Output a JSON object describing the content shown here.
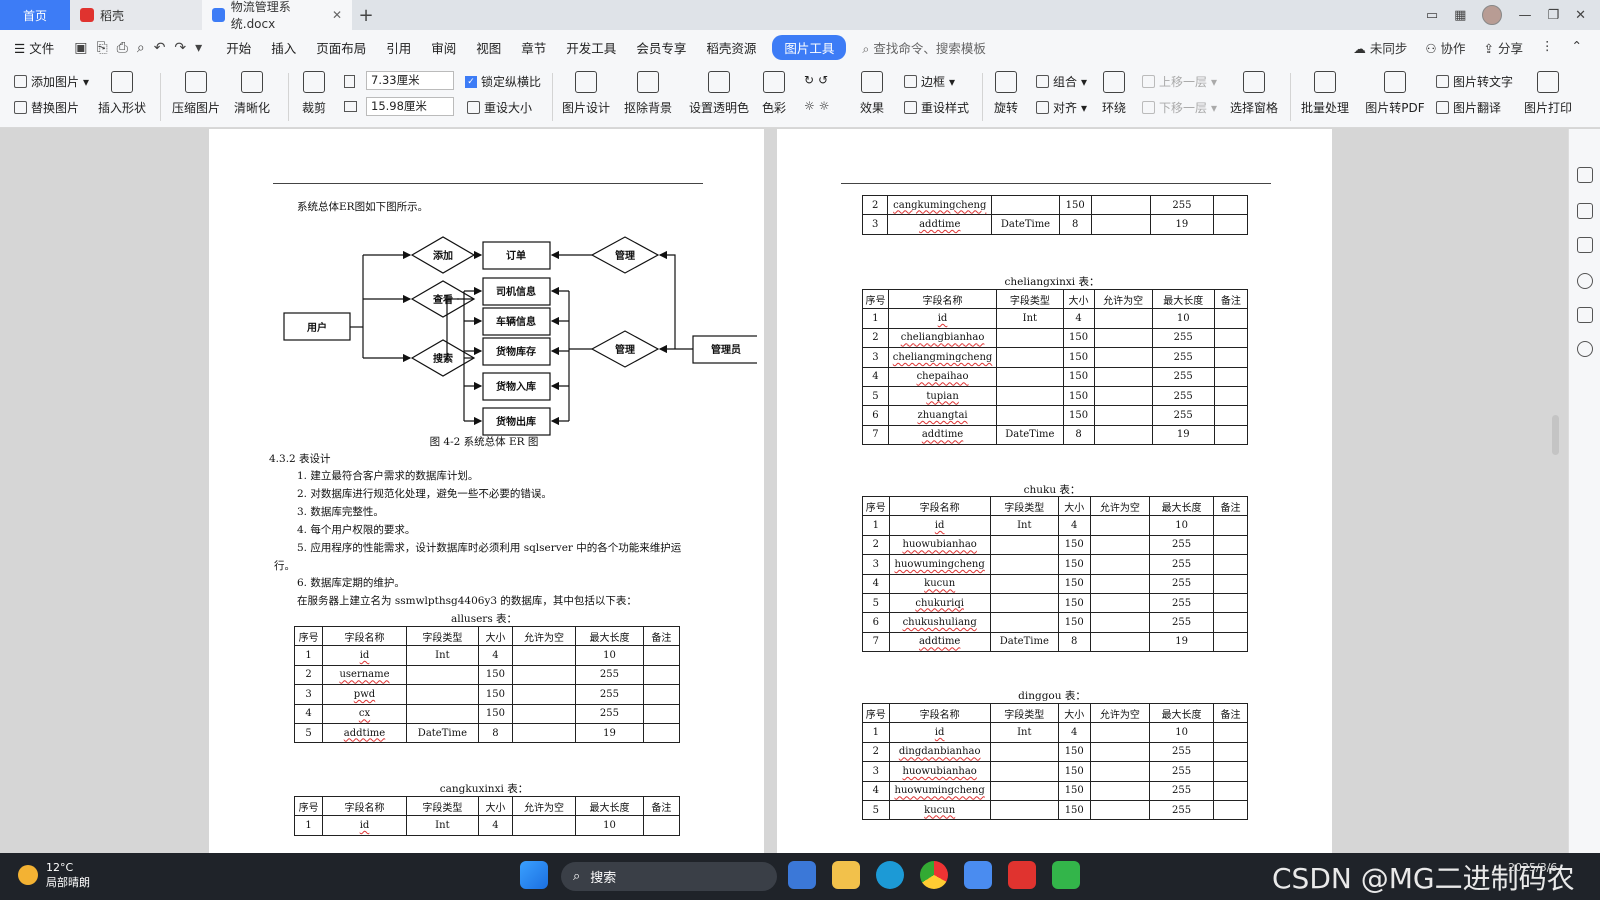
{
  "tabs": {
    "home": "首页",
    "daoke": "稻壳",
    "doc": "物流管理系统.docx"
  },
  "menu": {
    "file": "文件",
    "items": [
      "开始",
      "插入",
      "页面布局",
      "引用",
      "审阅",
      "视图",
      "章节",
      "开发工具",
      "会员专享",
      "稻壳资源"
    ],
    "active": "图片工具",
    "search_placeholder": "查找命令、搜索模板",
    "sync": "未同步",
    "collab": "协作",
    "share": "分享"
  },
  "ribbon": {
    "add_image": "添加图片",
    "replace_image": "替换图片",
    "insert_shape": "插入形状",
    "compress": "压缩图片",
    "sharpen": "清晰化",
    "crop": "裁剪",
    "width_value": "7.33厘米",
    "height_value": "15.98厘米",
    "lock_ratio": "锁定纵横比",
    "reset_size": "重设大小",
    "image_design": "图片设计",
    "remove_bg": "抠除背景",
    "set_transparent": "设置透明色",
    "color": "色彩",
    "effects": "效果",
    "border": "边框",
    "reset_style": "重设样式",
    "rotate": "旋转",
    "group": "组合",
    "align": "对齐",
    "wrap": "环绕",
    "move_up": "上移一层",
    "move_down": "下移一层",
    "select_pane": "选择窗格",
    "batch": "批量处理",
    "to_pdf": "图片转PDF",
    "to_text": "图片转文字",
    "translate": "图片翻译",
    "print": "图片打印"
  },
  "page1": {
    "intro": "系统总体ER图如下图所示。",
    "er": {
      "user": "用户",
      "add": "添加",
      "view": "查看",
      "search": "搜索",
      "order": "订单",
      "driver": "司机信息",
      "vehicle": "车辆信息",
      "stock": "货物库存",
      "in": "货物入库",
      "out": "货物出库",
      "manage1": "管理",
      "manage2": "管理",
      "admin": "管理员"
    },
    "caption": "图 4-2 系统总体 ER 图",
    "section": "4.3.2 表设计",
    "items": [
      "1. 建立最符合客户需求的数据库计划。",
      "2. 对数据库进行规范化处理，避免一些不必要的错误。",
      "3. 数据库完整性。",
      "4. 每个用户权限的要求。",
      "5. 应用程序的性能需求，设计数据库时必须利用 sqlserver 中的各个功能来维护运",
      "行。",
      "6. 数据库定期的维护。"
    ],
    "db_line": "在服务器上建立名为 ssmwlpthsg4406y3 的数据库，其中包括以下表：",
    "allusers_title": "allusers 表：",
    "cangku_title": "cangkuxinxi 表：",
    "headers": [
      "序号",
      "字段名称",
      "字段类型",
      "大小",
      "允许为空",
      "最大长度",
      "备注"
    ],
    "allusers_rows": [
      [
        "1",
        "id",
        "Int",
        "4",
        "",
        "10",
        ""
      ],
      [
        "2",
        "username",
        "",
        "150",
        "",
        "255",
        ""
      ],
      [
        "3",
        "pwd",
        "",
        "150",
        "",
        "255",
        ""
      ],
      [
        "4",
        "cx",
        "",
        "150",
        "",
        "255",
        ""
      ],
      [
        "5",
        "addtime",
        "DateTime",
        "8",
        "",
        "19",
        ""
      ]
    ],
    "cangku_rows": [
      [
        "1",
        "id",
        "Int",
        "4",
        "",
        "10",
        ""
      ]
    ]
  },
  "page2": {
    "top_rows": [
      [
        "2",
        "cangkumingcheng",
        "",
        "150",
        "",
        "255",
        ""
      ],
      [
        "3",
        "addtime",
        "DateTime",
        "8",
        "",
        "19",
        ""
      ]
    ],
    "cheliang_title": "cheliangxinxi 表：",
    "cheliang_rows": [
      [
        "1",
        "id",
        "Int",
        "4",
        "",
        "10",
        ""
      ],
      [
        "2",
        "cheliangbianhao",
        "",
        "150",
        "",
        "255",
        ""
      ],
      [
        "3",
        "cheliangmingcheng",
        "",
        "150",
        "",
        "255",
        ""
      ],
      [
        "4",
        "chepaihao",
        "",
        "150",
        "",
        "255",
        ""
      ],
      [
        "5",
        "tupian",
        "",
        "150",
        "",
        "255",
        ""
      ],
      [
        "6",
        "zhuangtai",
        "",
        "150",
        "",
        "255",
        ""
      ],
      [
        "7",
        "addtime",
        "DateTime",
        "8",
        "",
        "19",
        ""
      ]
    ],
    "chuku_title": "chuku 表：",
    "chuku_rows": [
      [
        "1",
        "id",
        "Int",
        "4",
        "",
        "10",
        ""
      ],
      [
        "2",
        "huowubianhao",
        "",
        "150",
        "",
        "255",
        ""
      ],
      [
        "3",
        "huowumingcheng",
        "",
        "150",
        "",
        "255",
        ""
      ],
      [
        "4",
        "kucun",
        "",
        "150",
        "",
        "255",
        ""
      ],
      [
        "5",
        "chukuriqi",
        "",
        "150",
        "",
        "255",
        ""
      ],
      [
        "6",
        "chukushuliang",
        "",
        "150",
        "",
        "255",
        ""
      ],
      [
        "7",
        "addtime",
        "DateTime",
        "8",
        "",
        "19",
        ""
      ]
    ],
    "dinggou_title": "dinggou 表：",
    "dinggou_rows": [
      [
        "1",
        "id",
        "Int",
        "4",
        "",
        "10",
        ""
      ],
      [
        "2",
        "dingdanbianhao",
        "",
        "150",
        "",
        "255",
        ""
      ],
      [
        "3",
        "huowubianhao",
        "",
        "150",
        "",
        "255",
        ""
      ],
      [
        "4",
        "huowumingcheng",
        "",
        "150",
        "",
        "255",
        ""
      ],
      [
        "5",
        "kucun",
        "",
        "150",
        "",
        "255",
        ""
      ]
    ]
  },
  "taskbar": {
    "temp": "12°C",
    "weather": "局部晴朗",
    "search": "搜索",
    "watermark": "CSDN @MG二进制码农",
    "clock": "2025/3/6"
  },
  "colors": {
    "accent": "#3d7cf6",
    "wps_red": "#e0332f"
  }
}
